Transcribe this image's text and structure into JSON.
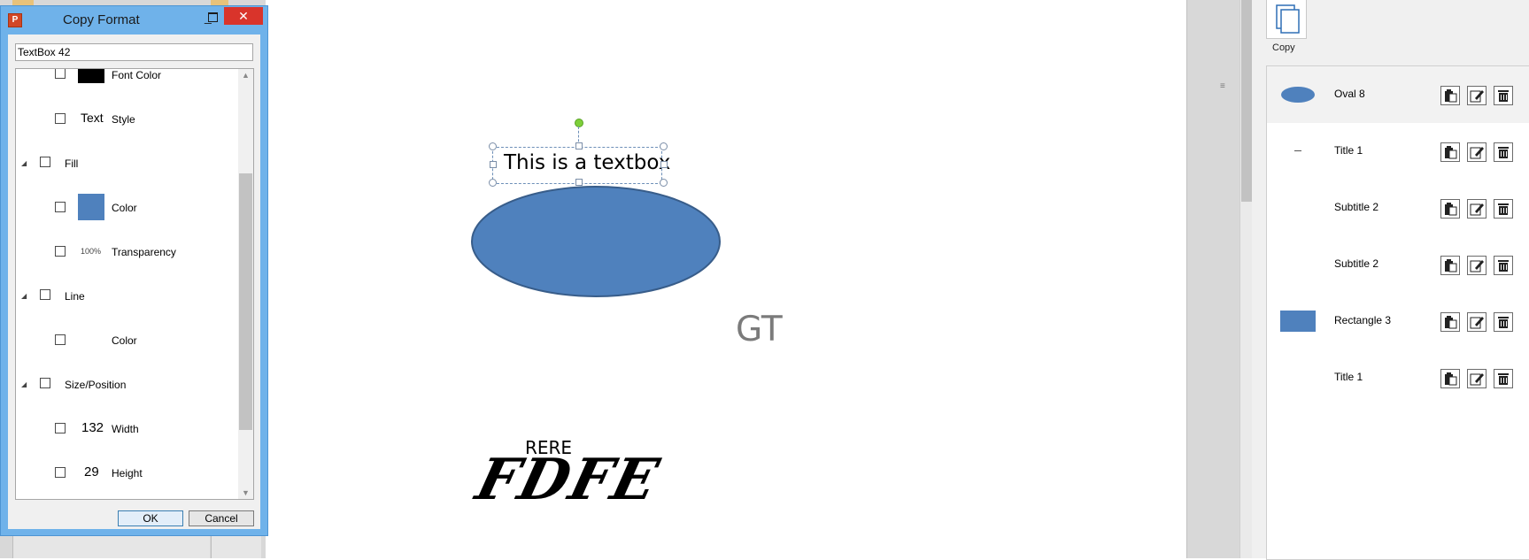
{
  "dialog": {
    "title": "Copy Format",
    "app_icon_letter": "P",
    "close_glyph": "✕",
    "name_value": "TextBox 42",
    "ok_label": "OK",
    "cancel_label": "Cancel",
    "tree": {
      "font_color_label": "Font Color",
      "style_preview": "Text",
      "style_label": "Style",
      "fill_label": "Fill",
      "fill_color_label": "Color",
      "transparency_preview": "100%",
      "transparency_label": "Transparency",
      "line_label": "Line",
      "line_color_label": "Color",
      "size_label": "Size/Position",
      "width_value": "132",
      "width_label": "Width",
      "height_value": "29",
      "height_label": "Height"
    },
    "colors": {
      "font_color": "#000000",
      "fill_color": "#4f81bd"
    }
  },
  "slide": {
    "textbox_text": "This is a textbox",
    "gt_text": "GT",
    "rere_text": "RERE",
    "fdfe_text": "FDFE",
    "shape_color": "#4f81bd"
  },
  "pane": {
    "copy_label": "Copy",
    "items": [
      {
        "label": "Oval 8",
        "thumb": "oval"
      },
      {
        "label": "Title 1",
        "thumb": "dash"
      },
      {
        "label": "Subtitle 2",
        "thumb": "none"
      },
      {
        "label": "Subtitle 2",
        "thumb": "none"
      },
      {
        "label": "Rectangle 3",
        "thumb": "rect"
      },
      {
        "label": "Title 1",
        "thumb": "none"
      }
    ]
  }
}
